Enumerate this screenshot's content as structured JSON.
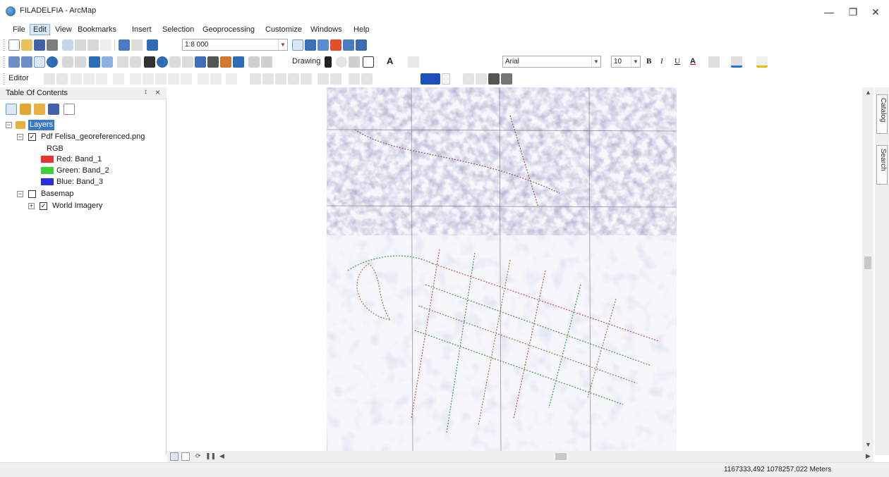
{
  "window": {
    "title": "FILADELFIA - ArcMap",
    "minimize_glyph": "—",
    "maximize_glyph": "❐",
    "close_glyph": "✕"
  },
  "menu": [
    "File",
    "Edit",
    "View",
    "Bookmarks",
    "Insert",
    "Selection",
    "Geoprocessing",
    "Customize",
    "Windows",
    "Help"
  ],
  "menu_active": "Edit",
  "toolbar1": {
    "scale": "1:8 000"
  },
  "toolbar2": {
    "drawing_label": "Drawing",
    "font_name": "Arial",
    "font_size": "10",
    "bold": "B",
    "italic": "I",
    "underline": "U",
    "text_color_glyph": "A"
  },
  "toolbar3": {
    "editor_label": "Editor"
  },
  "toc": {
    "title": "Table Of Contents",
    "pin_glyph": "↕",
    "close_glyph": "×",
    "layers_label": "Layers",
    "raster_layer": "Pdf Felisa_georeferenced.png",
    "rgb_label": "RGB",
    "bands": [
      {
        "label": "Red:  Band_1",
        "color": "#e8342e"
      },
      {
        "label": "Green: Band_2",
        "color": "#39d23a"
      },
      {
        "label": "Blue:  Band_3",
        "color": "#2c2ce0"
      }
    ],
    "basemap_label": "Basemap",
    "world_imagery_label": "World Imagery"
  },
  "dock": {
    "catalog_tab": "Catalog",
    "search_tab": "Search"
  },
  "status": {
    "coordinates": "1167333,492  1078257,022 Meters"
  },
  "colors": {
    "accent": "#3b6fb6",
    "highlight_bg": "#3b78c8",
    "imagery_tint": "#6b6a9e"
  }
}
